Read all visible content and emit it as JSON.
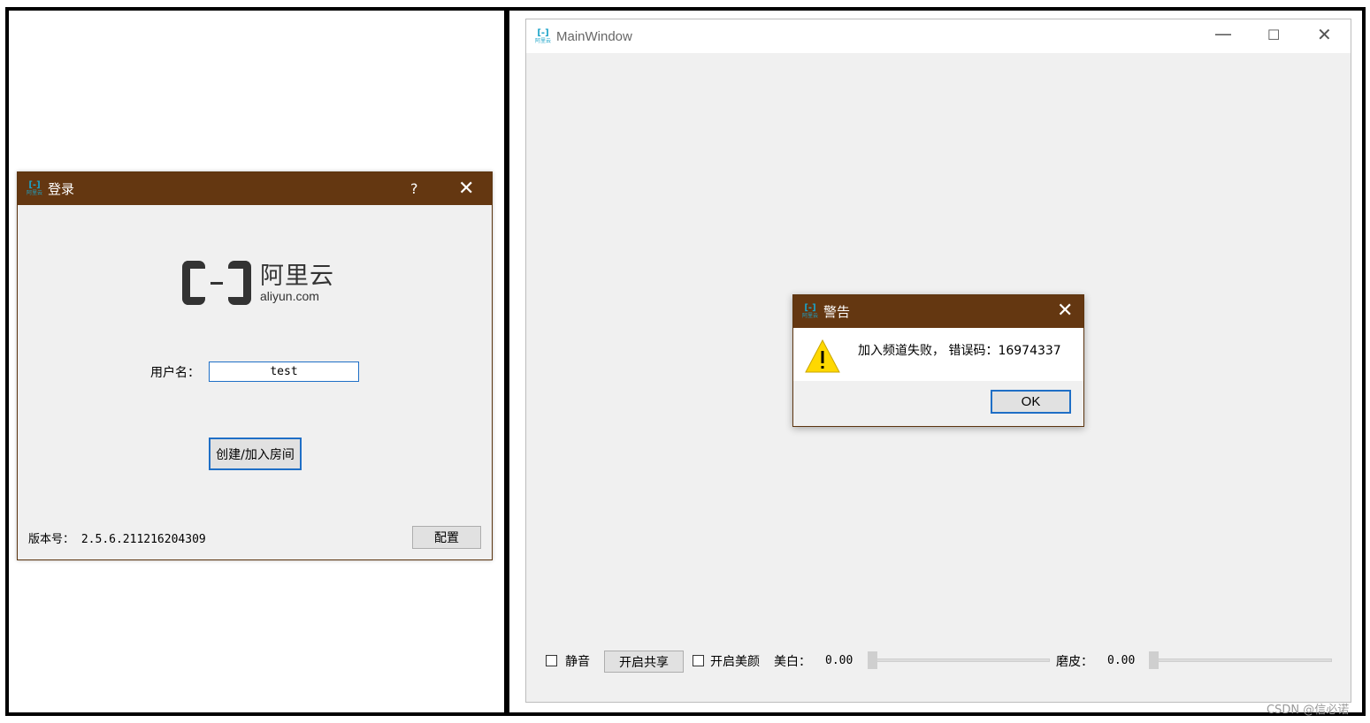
{
  "login_dialog": {
    "title": "登录",
    "help_label": "?",
    "close_label": "✕",
    "logo_cn": "阿里云",
    "logo_en": "aliyun.com",
    "username_label": "用户名：",
    "username_value": "test",
    "join_button": "创建/加入房间",
    "version_label": "版本号：",
    "version_value": "2.5.6.211216204309",
    "config_button": "配置"
  },
  "main_window": {
    "title": "MainWindow",
    "minimize_label": "—",
    "maximize_label": "☐",
    "close_label": "✕",
    "mute_label": "静音",
    "mute_checked": false,
    "share_button": "开启共享",
    "beauty_label": "开启美颜",
    "beauty_checked": false,
    "whiten_label": "美白：",
    "whiten_value": "0.00",
    "smooth_label": "磨皮：",
    "smooth_value": "0.00"
  },
  "warning_dialog": {
    "title": "警告",
    "close_label": "✕",
    "message": "加入频道失败， 错误码：16974337",
    "ok_button": "OK"
  },
  "app_icon": {
    "top": "[-]",
    "bottom": "阿里云"
  },
  "watermark": "CSDN @信必诺",
  "colors": {
    "titlebar": "#643711",
    "focus_border": "#1f6fc6",
    "dialog_bg": "#f0f0f0",
    "warning_yellow": "#ffd800"
  }
}
